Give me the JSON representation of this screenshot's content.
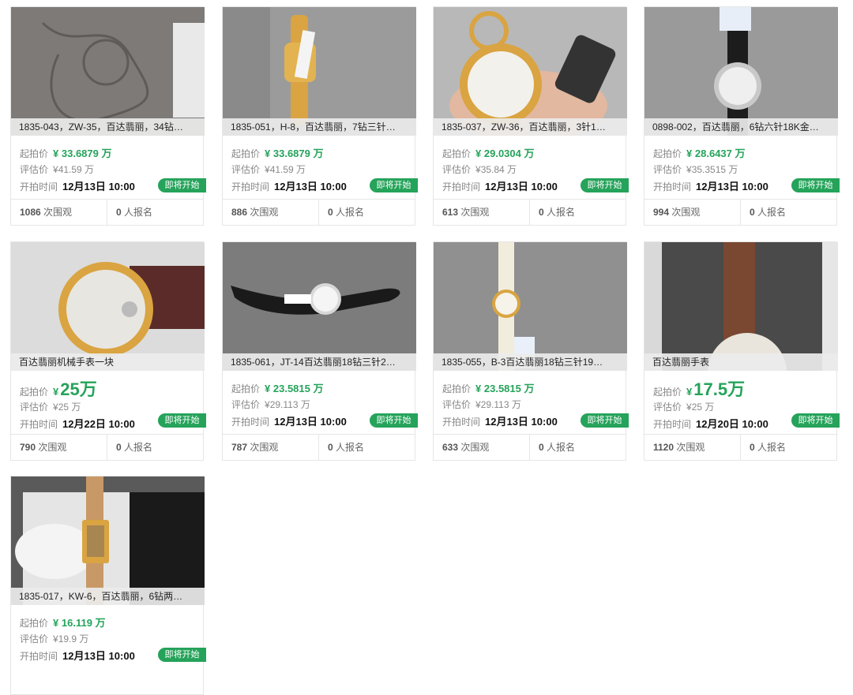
{
  "labels": {
    "start_price": "起拍价",
    "estimate": "评估价",
    "start_time": "开拍时间",
    "views_suffix": "次围观",
    "signups_suffix": "人报名",
    "badge": "即将开始",
    "yen": "¥"
  },
  "colors": {
    "accent": "#25a35a",
    "badge_bg": "#25a35a"
  },
  "lots": [
    {
      "title": "1835-043，ZW-35，百达翡丽，34钻…",
      "price": "33.6879 万",
      "estimate": "¥41.59 万",
      "time": "12月13日 10:00",
      "views": "1086",
      "signups": "0",
      "image": "engraved-box"
    },
    {
      "title": "1835-051，H-8，百达翡丽，7钻三针…",
      "price": "33.6879 万",
      "estimate": "¥41.59 万",
      "time": "12月13日 10:00",
      "views": "886",
      "signups": "0",
      "image": "gold-bracelet-watch"
    },
    {
      "title": "1835-037，ZW-36，百达翡丽，3针1…",
      "price": "29.0304 万",
      "estimate": "¥35.84 万",
      "time": "12月13日 10:00",
      "views": "613",
      "signups": "0",
      "image": "gold-pocket-watch"
    },
    {
      "title": "0898-002，百达翡丽，6钻六针18K金…",
      "price": "28.6437 万",
      "estimate": "¥35.3515 万",
      "time": "12月13日 10:00",
      "views": "994",
      "signups": "0",
      "image": "black-strap-watch"
    },
    {
      "title": "百达翡丽机械手表一块",
      "price": "25万",
      "estimate": "¥25 万",
      "time": "12月22日 10:00",
      "views": "790",
      "signups": "0",
      "big": true,
      "image": "rose-gold-watch-bag"
    },
    {
      "title": "1835-061，JT-14百达翡丽18钻三针2…",
      "price": "23.5815 万",
      "estimate": "¥29.113 万",
      "time": "12月13日 10:00",
      "views": "787",
      "signups": "0",
      "image": "black-strap-watch-flat"
    },
    {
      "title": "1835-055，B-3百达翡丽18钻三针19…",
      "price": "23.5815 万",
      "estimate": "¥29.113 万",
      "time": "12月13日 10:00",
      "views": "633",
      "signups": "0",
      "image": "white-strap-watch"
    },
    {
      "title": "百达翡丽手表",
      "price": "17.5万",
      "estimate": "¥25 万",
      "time": "12月20日 10:00",
      "views": "1120",
      "signups": "0",
      "big": true,
      "image": "brown-strap-watch"
    },
    {
      "title": "1835-017，KW-6，百达翡丽，6钻两…",
      "price": "16.119 万",
      "estimate": "¥19.9 万",
      "time": "12月13日 10:00",
      "views": "",
      "signups": "",
      "image": "rectangular-watch-box"
    }
  ]
}
